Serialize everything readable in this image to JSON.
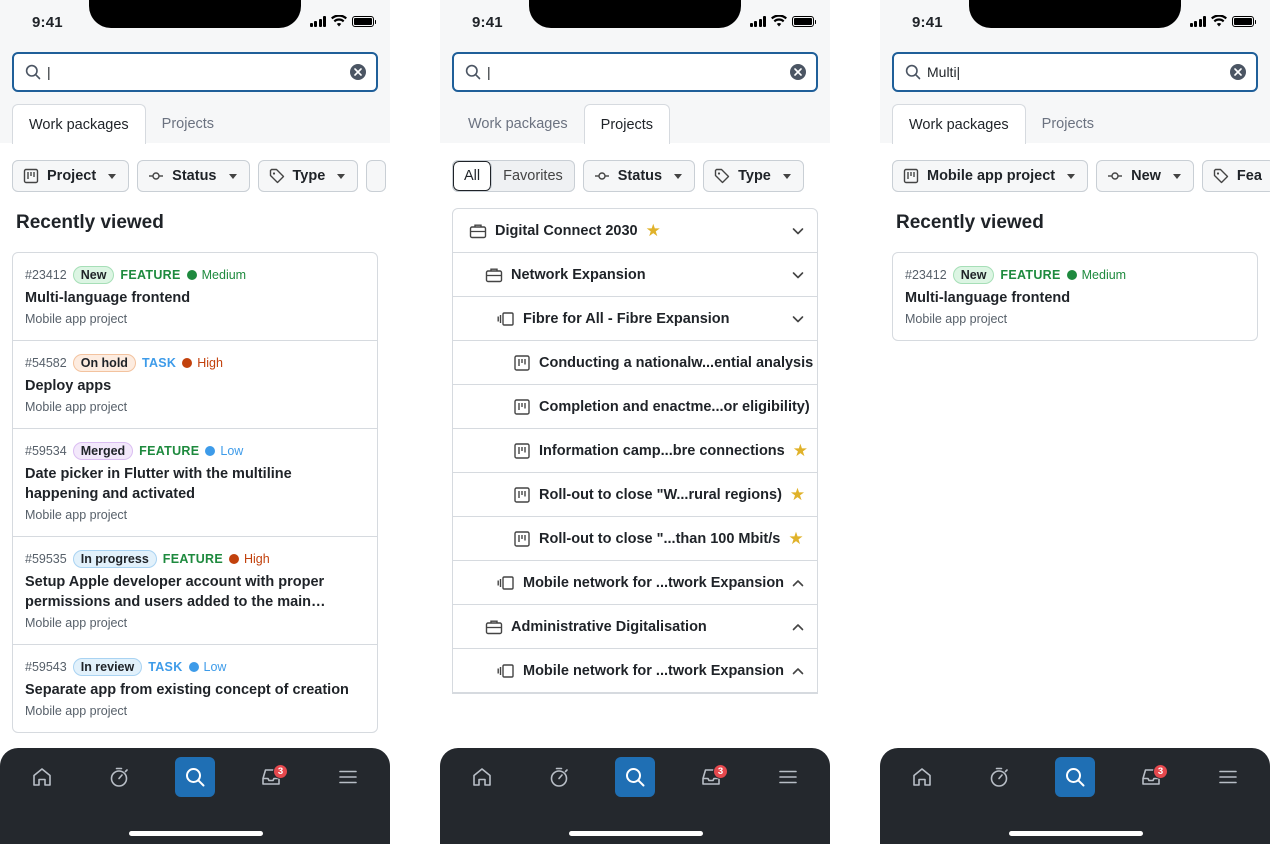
{
  "status_bar": {
    "time": "9:41"
  },
  "colors": {
    "accent": "#1f6fb4",
    "search_border": "#1f5f99",
    "feature": "#1e8a3e",
    "task": "#3d9be9",
    "star": "#e0b22a",
    "tabbar": "#24282d",
    "badge_red": "#e5484d"
  },
  "tabbar": {
    "icons": [
      "home-icon",
      "stopwatch-icon",
      "search-icon",
      "inbox-icon",
      "menu-icon"
    ],
    "notifications": "3"
  },
  "screens": [
    {
      "search": {
        "value": "|"
      },
      "tabs": [
        "Work packages",
        "Projects"
      ],
      "active_tab": 0,
      "filters": [
        "Project",
        "Status",
        "Type"
      ],
      "section_title": "Recently viewed",
      "items": [
        {
          "id": "#23412",
          "status": "New",
          "type": "FEATURE",
          "priority": "Medium",
          "title": "Multi-language frontend",
          "project": "Mobile app project"
        },
        {
          "id": "#54582",
          "status": "On hold",
          "type": "TASK",
          "priority": "High",
          "title": "Deploy apps",
          "project": "Mobile app project"
        },
        {
          "id": "#59534",
          "status": "Merged",
          "type": "FEATURE",
          "priority": "Low",
          "title": "Date picker in Flutter with the multiline happening and activated",
          "project": "Mobile app project"
        },
        {
          "id": "#59535",
          "status": "In progress",
          "type": "FEATURE",
          "priority": "High",
          "title": "Setup Apple developer account with proper permissions and users added to the main distribution list",
          "project": "Mobile app project"
        },
        {
          "id": "#59543",
          "status": "In review",
          "type": "TASK",
          "priority": "Low",
          "title": "Separate app from existing concept of creation",
          "project": "Mobile app project"
        }
      ]
    },
    {
      "search": {
        "value": "|"
      },
      "tabs": [
        "Work packages",
        "Projects"
      ],
      "active_tab": 1,
      "segment": [
        "All",
        "Favorites"
      ],
      "filters": [
        "Status",
        "Type"
      ],
      "tree": [
        {
          "label": "Digital Connect 2030",
          "icon": "briefcase-icon",
          "starred": true,
          "caret": "down"
        },
        {
          "label": "Network Expansion",
          "icon": "briefcase-icon",
          "starred": false,
          "caret": "down"
        },
        {
          "label": "Fibre for All - Fibre Expansion",
          "icon": "program-icon",
          "starred": false,
          "caret": "down"
        },
        {
          "label": "Conducting a nationalw...ential analysis",
          "icon": "board-icon",
          "starred": false,
          "caret": ""
        },
        {
          "label": "Completion and enactme...or eligibility)",
          "icon": "board-icon",
          "starred": false,
          "caret": ""
        },
        {
          "label": "Information camp...bre connections",
          "icon": "board-icon",
          "starred": true,
          "caret": ""
        },
        {
          "label": "Roll-out to close \"W...rural regions)",
          "icon": "board-icon",
          "starred": true,
          "caret": ""
        },
        {
          "label": "Roll-out to close \"...than 100 Mbit/s",
          "icon": "board-icon",
          "starred": true,
          "caret": ""
        },
        {
          "label": "Mobile network for ...twork Expansion",
          "icon": "program-icon",
          "starred": false,
          "caret": "up"
        },
        {
          "label": "Administrative Digitalisation",
          "icon": "briefcase-icon",
          "starred": false,
          "caret": "up"
        },
        {
          "label": "Mobile network for ...twork Expansion",
          "icon": "program-icon",
          "starred": false,
          "caret": "up"
        }
      ]
    },
    {
      "search": {
        "value": "Multi|"
      },
      "tabs": [
        "Work packages",
        "Projects"
      ],
      "active_tab": 0,
      "filters": [
        "Mobile app project",
        "New",
        "Fea"
      ],
      "section_title": "Recently viewed",
      "items": [
        {
          "id": "#23412",
          "status": "New",
          "type": "FEATURE",
          "priority": "Medium",
          "title": "Multi-language frontend",
          "project": "Mobile app project"
        }
      ]
    }
  ]
}
